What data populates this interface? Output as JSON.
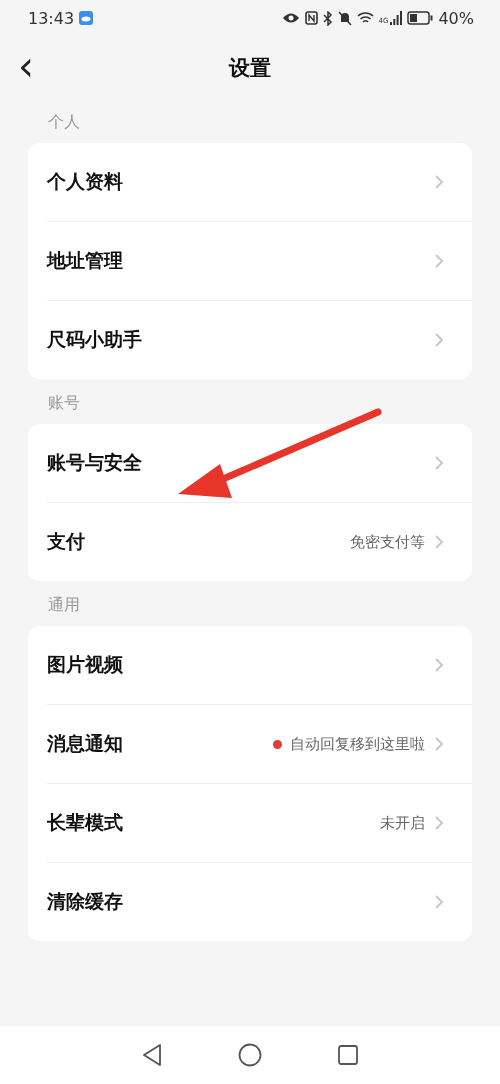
{
  "status_bar": {
    "time": "13:43",
    "network": "4G",
    "battery": "40%"
  },
  "header": {
    "back": "‹",
    "title": "设置"
  },
  "sections": [
    {
      "label": "个人",
      "items": [
        {
          "label": "个人资料",
          "dot": false
        },
        {
          "label": "地址管理",
          "dot": false
        },
        {
          "label": "尺码小助手",
          "dot": false
        }
      ]
    },
    {
      "label": "账号",
      "items": [
        {
          "label": "账号与安全",
          "dot": false,
          "annotated": true
        },
        {
          "label": "支付",
          "value": "免密支付等",
          "dot": false
        }
      ]
    },
    {
      "label": "通用",
      "items": [
        {
          "label": "图片视频",
          "dot": false
        },
        {
          "label": "消息通知",
          "value": "自动回复移到这里啦",
          "dot": true
        },
        {
          "label": "长辈模式",
          "value": "未开启",
          "dot": false
        },
        {
          "label": "清除缓存",
          "dot": false
        }
      ]
    }
  ]
}
